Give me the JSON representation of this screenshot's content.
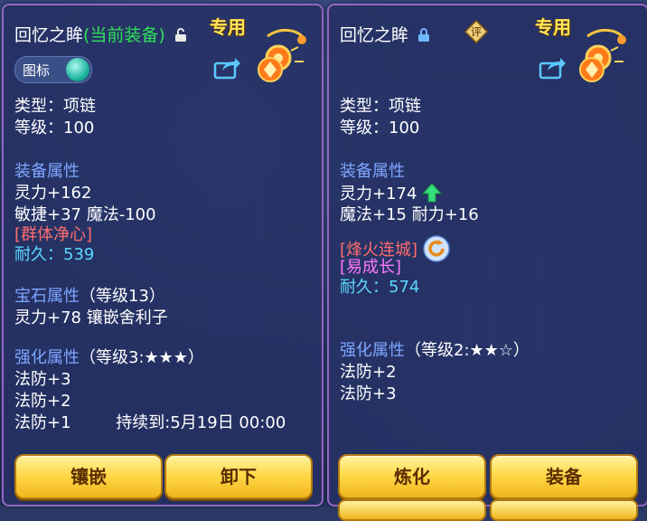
{
  "left": {
    "title_name": "回忆之眸",
    "title_equipped": "(当前装备)",
    "special": "专用",
    "toggle_label": "图标",
    "type_line": "类型：项链",
    "level_line": "等级：100",
    "equip_attr_header": "装备属性",
    "attrs": [
      "灵力+162",
      "敏捷+37 魔法-100"
    ],
    "special_effect": "[群体净心]",
    "durability": "耐久：539",
    "gem_header": "宝石属性",
    "gem_level": "（等级13）",
    "gem_line": "灵力+78 镶嵌舍利子",
    "enhance_header": "强化属性",
    "enhance_level": "（等级3:★★★）",
    "enhance_lines": [
      "法防+3",
      "法防+2"
    ],
    "enhance_last": "法防+1",
    "enhance_duration": "持续到:5月19日 00:00",
    "btn_inlay": "镶嵌",
    "btn_unequip": "卸下"
  },
  "right": {
    "title_name": "回忆之眸",
    "rating_badge": "评",
    "special": "专用",
    "type_line": "类型：项链",
    "level_line": "等级：100",
    "equip_attr_header": "装备属性",
    "attr1": "灵力+174",
    "attr2": "魔法+15 耐力+16",
    "special_effect": "[烽火连城]",
    "special_effect2": "[易成长]",
    "durability": "耐久：574",
    "enhance_header": "强化属性",
    "enhance_level": "（等级2:★★☆）",
    "enhance_lines": [
      "法防+2",
      "法防+3"
    ],
    "btn_refine": "炼化",
    "btn_equip": "装备"
  },
  "colors": {
    "panel_border": "#8c6ac4",
    "header": "#7ea6ff",
    "equipped": "#2ee05a",
    "red_effect": "#ff6d6d",
    "durability": "#59d8ff",
    "purple_effect": "#ff78ff",
    "special_tag": "#ffe65a"
  }
}
